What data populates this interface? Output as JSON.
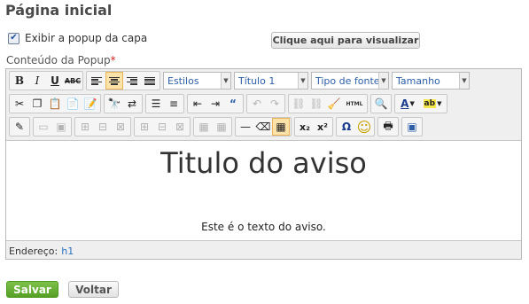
{
  "page": {
    "title": "Página inicial"
  },
  "popup": {
    "checkbox_label": "Exibir a popup da capa",
    "checked": true,
    "preview_button": "Clique aqui para visualizar",
    "content_label": "Conteúdo da Popup",
    "required_mark": "*"
  },
  "toolbar": {
    "bold": "B",
    "italic": "I",
    "underline": "U",
    "strike": "ABC",
    "styles": "Estilos",
    "format": "Título 1",
    "font": "Tipo de fonte",
    "size": "Tamanho",
    "html": "HTML",
    "omega": "Ω",
    "subscript": "x₂",
    "superscript": "x²",
    "smiley": "☺"
  },
  "editor": {
    "heading": "Titulo do aviso",
    "paragraph": "Este é o texto do aviso.",
    "status_label": "Endereço:",
    "status_path": "h1"
  },
  "actions": {
    "save": "Salvar",
    "back": "Voltar"
  },
  "colors": {
    "save_green": "#5aa628",
    "link_blue": "#2d6fc1",
    "required_red": "#d22222"
  }
}
